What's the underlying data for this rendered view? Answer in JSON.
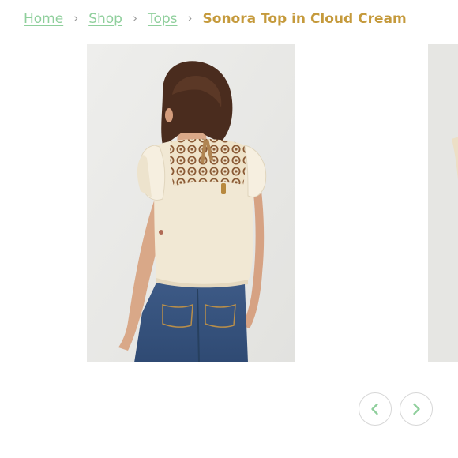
{
  "breadcrumb": {
    "items": [
      {
        "label": "Home"
      },
      {
        "label": "Shop"
      },
      {
        "label": "Tops"
      }
    ],
    "separator": "›",
    "current": "Sonora Top in Cloud Cream"
  },
  "colors": {
    "link": "#8fcf9c",
    "current": "#c59a3c",
    "arrow_icon": "#8fcf9c",
    "arrow_border": "#d7d7d7"
  },
  "gallery": {
    "images": [
      {
        "icon": "product-photo",
        "subject": "back view of cream flutter-sleeve top with embroidered yoke, worn with blue jeans"
      },
      {
        "icon": "product-photo",
        "subject": "next product photo (partially visible)"
      }
    ],
    "prev_icon": "chevron-left-icon",
    "next_icon": "chevron-right-icon"
  }
}
